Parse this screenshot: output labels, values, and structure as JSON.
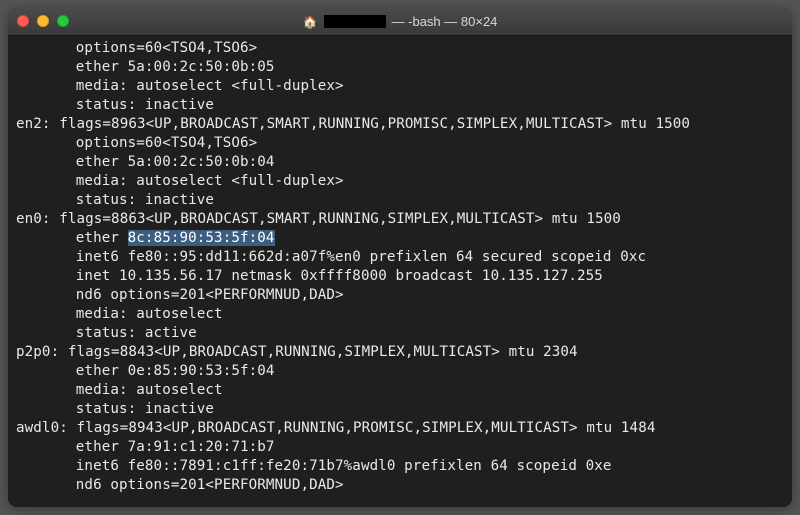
{
  "window": {
    "home_icon": "🏠",
    "title_suffix": "— -bash — 80×24"
  },
  "lines": [
    {
      "cls": "indent1",
      "text": "options=60<TSO4,TSO6>"
    },
    {
      "cls": "indent1",
      "text": "ether 5a:00:2c:50:0b:05"
    },
    {
      "cls": "indent1",
      "text": "media: autoselect <full-duplex>"
    },
    {
      "cls": "indent1",
      "text": "status: inactive"
    },
    {
      "cls": "iface",
      "text": "en2: flags=8963<UP,BROADCAST,SMART,RUNNING,PROMISC,SIMPLEX,MULTICAST> mtu 1500"
    },
    {
      "cls": "indent1",
      "text": "options=60<TSO4,TSO6>"
    },
    {
      "cls": "indent1",
      "text": "ether 5a:00:2c:50:0b:04"
    },
    {
      "cls": "indent1",
      "text": "media: autoselect <full-duplex>"
    },
    {
      "cls": "indent1",
      "text": "status: inactive"
    },
    {
      "cls": "iface",
      "text": "en0: flags=8863<UP,BROADCAST,SMART,RUNNING,SIMPLEX,MULTICAST> mtu 1500"
    },
    {
      "cls": "indent1",
      "text": "ether ",
      "hl": "8c:85:90:53:5f:04"
    },
    {
      "cls": "indent1",
      "text": "inet6 fe80::95:dd11:662d:a07f%en0 prefixlen 64 secured scopeid 0xc"
    },
    {
      "cls": "indent1",
      "text": "inet 10.135.56.17 netmask 0xffff8000 broadcast 10.135.127.255"
    },
    {
      "cls": "indent1",
      "text": "nd6 options=201<PERFORMNUD,DAD>"
    },
    {
      "cls": "indent1",
      "text": "media: autoselect"
    },
    {
      "cls": "indent1",
      "text": "status: active"
    },
    {
      "cls": "iface",
      "text": "p2p0: flags=8843<UP,BROADCAST,RUNNING,SIMPLEX,MULTICAST> mtu 2304"
    },
    {
      "cls": "indent1",
      "text": "ether 0e:85:90:53:5f:04"
    },
    {
      "cls": "indent1",
      "text": "media: autoselect"
    },
    {
      "cls": "indent1",
      "text": "status: inactive"
    },
    {
      "cls": "iface",
      "text": "awdl0: flags=8943<UP,BROADCAST,RUNNING,PROMISC,SIMPLEX,MULTICAST> mtu 1484"
    },
    {
      "cls": "indent1",
      "text": "ether 7a:91:c1:20:71:b7"
    },
    {
      "cls": "indent1",
      "text": "inet6 fe80::7891:c1ff:fe20:71b7%awdl0 prefixlen 64 scopeid 0xe"
    },
    {
      "cls": "indent1",
      "text": "nd6 options=201<PERFORMNUD,DAD>"
    }
  ]
}
